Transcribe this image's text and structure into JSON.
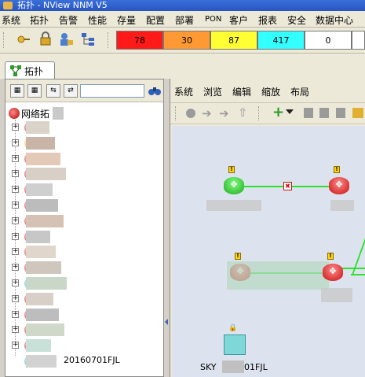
{
  "window": {
    "title": "拓扑 - NView NNM V5"
  },
  "menubar": {
    "items": [
      "系统",
      "拓扑",
      "告警",
      "性能",
      "存量",
      "配置",
      "部署",
      "PON",
      "客户",
      "报表",
      "安全",
      "数据中心"
    ]
  },
  "alarm_counters": [
    {
      "name": "critical",
      "value": "78",
      "color": "#ff1a1a"
    },
    {
      "name": "major",
      "value": "30",
      "color": "#ff9933"
    },
    {
      "name": "minor",
      "value": "87",
      "color": "#ffff33"
    },
    {
      "name": "warning",
      "value": "417",
      "color": "#33ffff"
    },
    {
      "name": "indeterminate",
      "value": "0",
      "color": "#ffffff"
    }
  ],
  "tabs": [
    {
      "label": "拓扑",
      "active": true
    }
  ],
  "tree": {
    "search_value": "",
    "root_label": "网络拓",
    "items": [
      {
        "expander": "+",
        "label": ""
      },
      {
        "expander": "+",
        "label": ""
      },
      {
        "expander": "+",
        "label": ""
      },
      {
        "expander": "+",
        "label": ""
      },
      {
        "expander": "+",
        "label": ""
      },
      {
        "expander": "+",
        "label": ""
      },
      {
        "expander": "+",
        "label": ""
      },
      {
        "expander": "+",
        "label": ""
      },
      {
        "expander": "+",
        "label": ""
      },
      {
        "expander": "+",
        "label": ""
      },
      {
        "expander": "+",
        "label": ""
      },
      {
        "expander": "+",
        "label": ""
      },
      {
        "expander": "+",
        "label": ""
      },
      {
        "expander": "+",
        "label": ""
      },
      {
        "expander": "+",
        "label": ""
      },
      {
        "expander": "",
        "label": "20160701FJL"
      }
    ]
  },
  "topo_menu": {
    "items": [
      "系统",
      "浏览",
      "编辑",
      "缩放",
      "布局"
    ]
  },
  "topo": {
    "device_label": "SKY",
    "device_label_suffix": "01FJL"
  }
}
